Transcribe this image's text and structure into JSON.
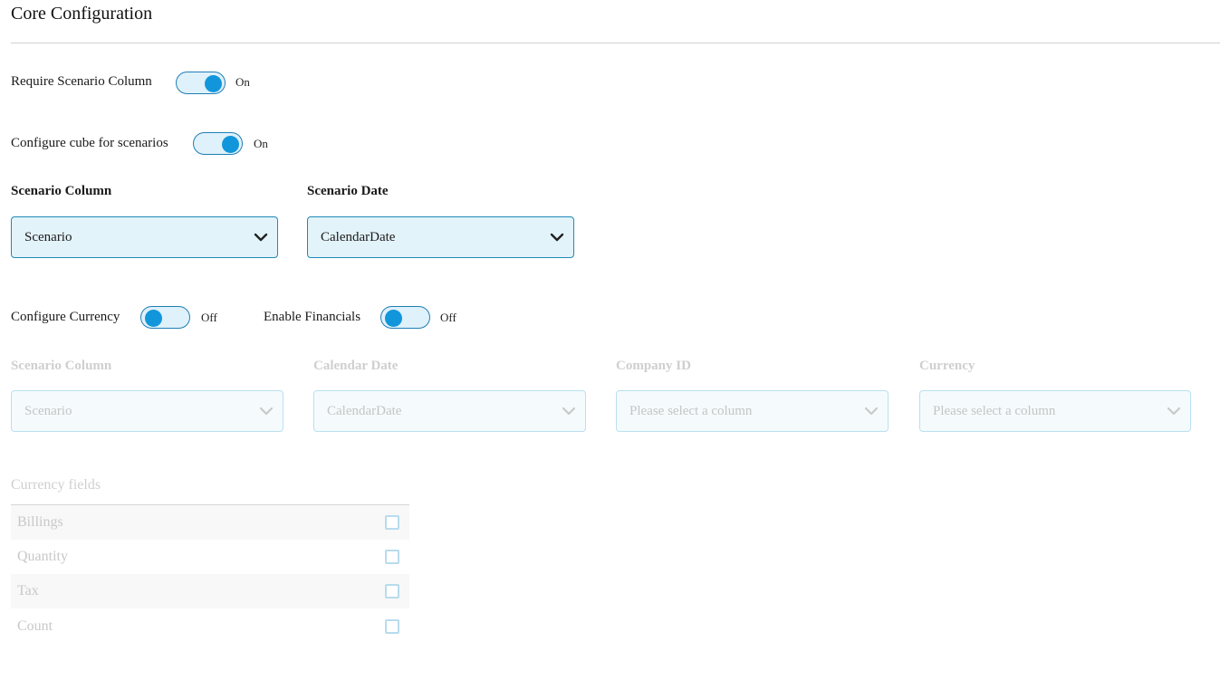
{
  "page": {
    "title": "Core Configuration"
  },
  "toggles": {
    "require_scenario": {
      "label": "Require Scenario Column",
      "state": "On"
    },
    "cube_scenarios": {
      "label": "Configure cube for scenarios",
      "state": "On"
    },
    "currency": {
      "label": "Configure Currency",
      "state": "Off"
    },
    "financials": {
      "label": "Enable Financials",
      "state": "Off"
    }
  },
  "scenario_fields": {
    "column": {
      "label": "Scenario Column",
      "value": "Scenario"
    },
    "date": {
      "label": "Scenario Date",
      "value": "CalendarDate"
    }
  },
  "currency_fields": {
    "scenario_column": {
      "label": "Scenario Column",
      "value": "Scenario"
    },
    "calendar_date": {
      "label": "Calendar Date",
      "value": "CalendarDate"
    },
    "company_id": {
      "label": "Company ID",
      "value": "Please select a column"
    },
    "currency": {
      "label": "Currency",
      "value": "Please select a column"
    }
  },
  "currency_list": {
    "title": "Currency fields",
    "items": [
      {
        "label": "Billings",
        "checked": false
      },
      {
        "label": "Quantity",
        "checked": false
      },
      {
        "label": "Tax",
        "checked": false
      },
      {
        "label": "Count",
        "checked": false
      }
    ]
  },
  "colors": {
    "accent": "#1296db",
    "border": "#1f8ab8",
    "fill": "#e3f3fa"
  },
  "icons": {
    "select_arrow": "chevron-down-icon",
    "checkbox": "checkbox-icon"
  }
}
